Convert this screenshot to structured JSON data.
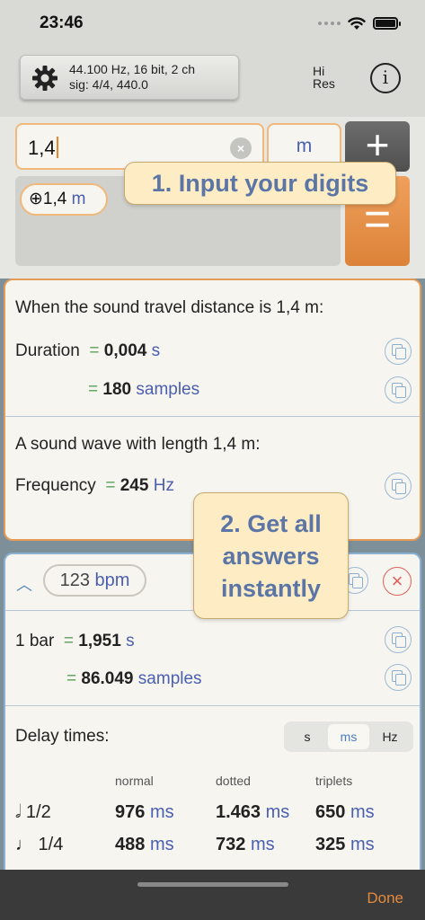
{
  "status_bar": {
    "time": "23:46"
  },
  "header": {
    "settings_line1": "44.100 Hz, 16 bit, 2 ch",
    "settings_line2": "sig: 4/4, 440.0",
    "hires_line1": "Hi",
    "hires_line2": "Res",
    "info_label": "i"
  },
  "input": {
    "value": "1,4",
    "unit": "m",
    "plus_label": "+",
    "equals_label": "=",
    "token_value": "1,4",
    "token_unit": "m"
  },
  "callouts": {
    "first": "1. Input your digits",
    "second": "2. Get all answers instantly"
  },
  "distance_card": {
    "heading": "When the sound travel distance is 1,4 m:",
    "duration_label": "Duration",
    "duration_value": "0,004",
    "duration_unit": "s",
    "samples_value": "180",
    "samples_unit": "samples",
    "wave_heading": "A sound wave with length 1,4 m:",
    "frequency_label": "Frequency",
    "frequency_value": "245",
    "frequency_unit": "Hz"
  },
  "bpm_card": {
    "bpm_value": "123",
    "bpm_unit": "bpm",
    "bar_label": "1 bar",
    "bar_value": "1,951",
    "bar_unit": "s",
    "bar_samples_value": "86.049",
    "bar_samples_unit": "samples",
    "delay_label": "Delay times:",
    "segments": [
      "s",
      "ms",
      "Hz"
    ],
    "active_segment": "ms",
    "columns": [
      "normal",
      "dotted",
      "triplets"
    ],
    "rows": [
      {
        "note": "𝅗𝅥 1/2",
        "normal": "976",
        "dotted": "1.463",
        "triplets": "650",
        "unit": "ms"
      },
      {
        "note": "♩ 1/4",
        "normal": "488",
        "dotted": "732",
        "triplets": "325",
        "unit": "ms"
      }
    ]
  },
  "bottom_bar": {
    "done_label": "Done"
  },
  "colors": {
    "accent_orange": "#e38a3e",
    "accent_blue": "#4a5fb0",
    "equals_green": "#5aa05a",
    "callout_bg": "#fdecc4"
  }
}
